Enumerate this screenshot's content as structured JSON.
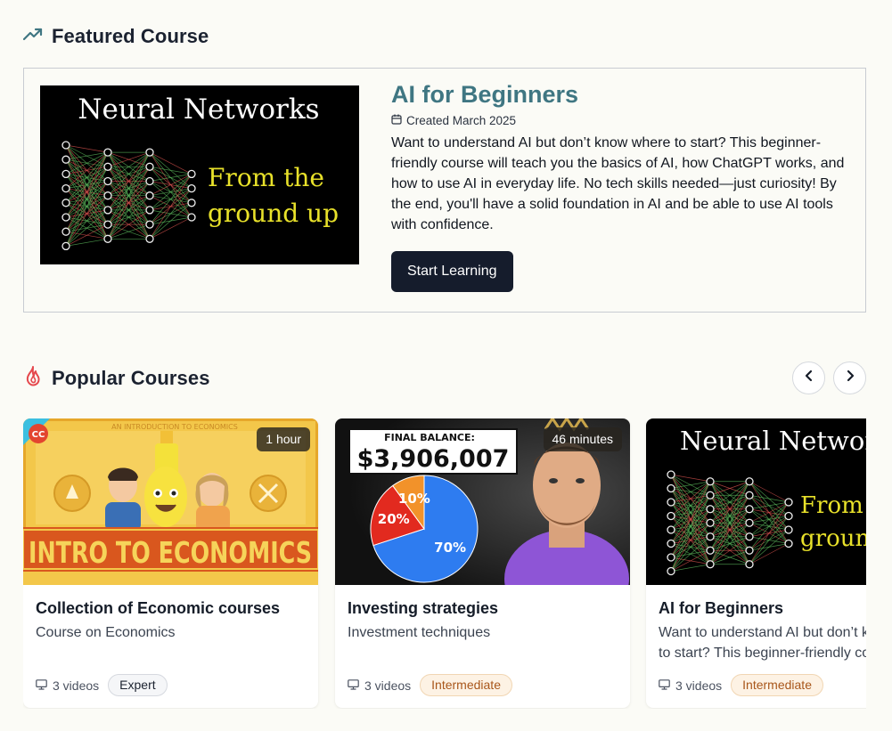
{
  "featured": {
    "heading": "Featured Course",
    "icon": "trending-up-icon",
    "thumbnail": {
      "title": "Neural Networks",
      "line1": "From the",
      "line2": "ground up"
    },
    "title": "AI for Beginners",
    "created": "Created March 2025",
    "description": "Want to understand AI but don’t know where to start? This beginner-friendly course will teach you the basics of AI, how ChatGPT works, and how to use AI in everyday life. No tech skills needed—just curiosity! By the end, you'll have a solid foundation in AI and be able to use AI tools with confidence.",
    "button": "Start Learning"
  },
  "popular": {
    "heading": "Popular Courses",
    "icon": "flame-icon",
    "courses": [
      {
        "title": "Collection of Economic courses",
        "subtitle": "Course on Economics",
        "duration": "1 hour",
        "videos": "3 videos",
        "level": "Expert",
        "thumb": {
          "banner_top": "AN INTRODUCTION TO ECONOMICS",
          "logo": "CC",
          "big_text": "INTRO TO ECONOMICS"
        }
      },
      {
        "title": "Investing strategies",
        "subtitle": "Investment techniques",
        "duration": "46 minutes",
        "videos": "3 videos",
        "level": "Intermediate",
        "thumb": {
          "label": "FINAL BALANCE:",
          "amount": "$3,906,007",
          "pie": [
            {
              "label": "70%",
              "value": 70,
              "color": "#2e7cf0"
            },
            {
              "label": "20%",
              "value": 20,
              "color": "#e22a1f"
            },
            {
              "label": "10%",
              "value": 10,
              "color": "#f2922a"
            }
          ]
        }
      },
      {
        "title": "AI for Beginners",
        "subtitle": "Want to understand AI but don’t know where to start? This beginner-friendly course",
        "duration": "",
        "videos": "3 videos",
        "level": "Intermediate",
        "thumb": {
          "title": "Neural Networks",
          "line1": "From the",
          "line2": "ground up"
        }
      }
    ]
  },
  "colors": {
    "accent": "#3f7682",
    "button_bg": "#151c2c",
    "flame": "#e5484d",
    "intermediate_text": "#a8561a"
  }
}
